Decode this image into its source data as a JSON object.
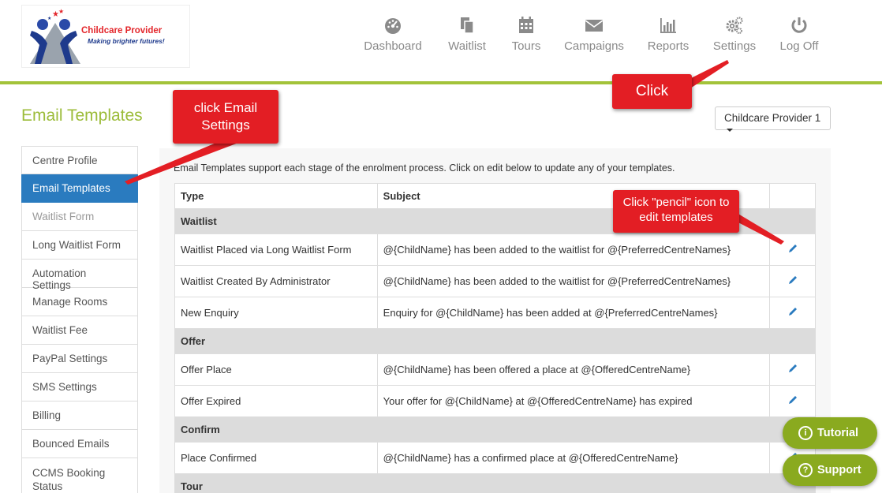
{
  "logo": {
    "brand": "Childcare Provider",
    "tagline": "Making brighter futures!"
  },
  "nav": [
    {
      "label": "Dashboard",
      "icon": "dashboard-icon"
    },
    {
      "label": "Waitlist",
      "icon": "waitlist-icon"
    },
    {
      "label": "Tours",
      "icon": "calendar-icon"
    },
    {
      "label": "Campaigns",
      "icon": "envelope-icon"
    },
    {
      "label": "Reports",
      "icon": "bar-chart-icon"
    },
    {
      "label": "Settings",
      "icon": "gears-icon"
    },
    {
      "label": "Log Off",
      "icon": "power-icon"
    }
  ],
  "page": {
    "title": "Email Templates",
    "centre_select": "Childcare Provider 1",
    "intro": "Email Templates support each stage of the enrolment process. Click on edit below to update any of your templates."
  },
  "sidebar": [
    {
      "label": "Centre Profile"
    },
    {
      "label": "Email Templates"
    },
    {
      "label": "Waitlist Form"
    },
    {
      "label": "Long Waitlist Form"
    },
    {
      "label": "Automation Settings"
    },
    {
      "label": "Manage Rooms"
    },
    {
      "label": "Waitlist Fee"
    },
    {
      "label": "PayPal Settings"
    },
    {
      "label": "SMS Settings"
    },
    {
      "label": "Billing"
    },
    {
      "label": "Bounced Emails"
    },
    {
      "label": "CCMS Booking Status"
    }
  ],
  "table": {
    "headers": {
      "type": "Type",
      "subject": "Subject"
    },
    "groups": [
      {
        "name": "Waitlist",
        "rows": [
          {
            "type": "Waitlist Placed via Long Waitlist Form",
            "subject": "@{ChildName} has been added to the waitlist for @{PreferredCentreNames}"
          },
          {
            "type": "Waitlist Created By Administrator",
            "subject": "@{ChildName} has been added to the waitlist for @{PreferredCentreNames}"
          },
          {
            "type": "New Enquiry",
            "subject": "Enquiry for @{ChildName} has been added at @{PreferredCentreNames}"
          }
        ]
      },
      {
        "name": "Offer",
        "rows": [
          {
            "type": "Offer Place",
            "subject": "@{ChildName} has been offered a place at @{OfferedCentreName}"
          },
          {
            "type": "Offer Expired",
            "subject": "Your offer for @{ChildName} at @{OfferedCentreName} has expired"
          }
        ]
      },
      {
        "name": "Confirm",
        "rows": [
          {
            "type": "Place Confirmed",
            "subject": "@{ChildName} has a confirmed place at @{OfferedCentreName}"
          }
        ]
      },
      {
        "name": "Tour",
        "rows": []
      }
    ]
  },
  "callouts": {
    "settings": "Click",
    "email_settings": "click Email Settings",
    "pencil": "Click \"pencil\" icon to edit templates"
  },
  "fabs": {
    "tutorial": "Tutorial",
    "support": "Support"
  },
  "colors": {
    "accent_green": "#9cbc3a",
    "active_blue": "#2a7bbf",
    "callout_red": "#e31e24",
    "fab_green": "#8aaa1f"
  }
}
